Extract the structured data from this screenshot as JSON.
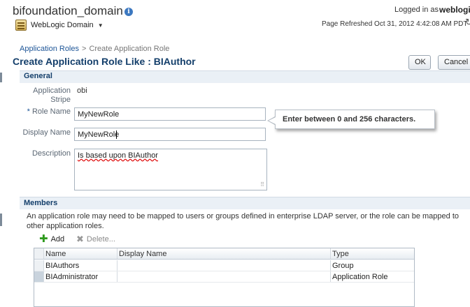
{
  "header": {
    "domain_title": "bifoundation_domain",
    "domain_menu_label": "WebLogic Domain",
    "logged_in_label": "Logged in as",
    "logged_in_user": "weblogi",
    "page_refreshed": "Page Refreshed Oct 31, 2012 4:42:08 AM PDT"
  },
  "breadcrumb": {
    "parent": "Application Roles",
    "separator": ">",
    "current": "Create Application Role"
  },
  "page": {
    "title": "Create Application Role Like : BIAuthor",
    "ok_label": "OK",
    "cancel_label": "Cancel"
  },
  "general": {
    "section_title": "General",
    "stripe_label": "Application Stripe",
    "stripe_value": "obi",
    "role_name_required_mark": "*",
    "role_name_label": "Role Name",
    "role_name_value": "MyNewRole",
    "display_name_label": "Display Name",
    "display_name_value": "MyNewRole",
    "description_label": "Description",
    "description_value": "Is based upon BIAuthor",
    "tooltip_text": "Enter between 0 and 256 characters."
  },
  "members": {
    "section_title": "Members",
    "description": "An application role may need to be mapped to users or groups defined in enterprise LDAP server, or the role can be mapped to other application roles.",
    "add_label": "Add",
    "delete_label": "Delete...",
    "columns": [
      "Name",
      "Display Name",
      "Type"
    ],
    "rows": [
      {
        "name": "BIAuthors",
        "display_name": "",
        "type": "Group"
      },
      {
        "name": "BIAdministrator",
        "display_name": "",
        "type": "Application Role"
      }
    ]
  },
  "colors": {
    "title_blue": "#143f6b",
    "link_blue": "#1d5597",
    "section_bg": "#eaf0f6",
    "add_green": "#2f9a1e"
  },
  "icons": [
    "info-icon",
    "weblogic-domain-icon",
    "chevron-down-icon",
    "refresh-icon",
    "add-icon",
    "delete-icon"
  ]
}
